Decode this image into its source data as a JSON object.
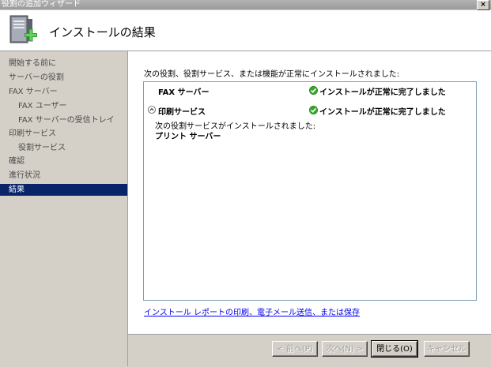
{
  "window": {
    "title": "役割の追加ウィザード",
    "close_glyph": "×"
  },
  "header": {
    "title": "インストールの結果"
  },
  "sidebar": {
    "items": [
      {
        "label": "開始する前に",
        "level": 1,
        "active": false
      },
      {
        "label": "サーバーの役割",
        "level": 1,
        "active": false
      },
      {
        "label": "FAX サーバー",
        "level": 1,
        "active": false
      },
      {
        "label": "FAX ユーザー",
        "level": 2,
        "active": false
      },
      {
        "label": "FAX サーバーの受信トレイ",
        "level": 2,
        "active": false
      },
      {
        "label": "印刷サービス",
        "level": 1,
        "active": false
      },
      {
        "label": "役割サービス",
        "level": 2,
        "active": false
      },
      {
        "label": "確認",
        "level": 1,
        "active": false
      },
      {
        "label": "進行状況",
        "level": 1,
        "active": false
      },
      {
        "label": "結果",
        "level": 1,
        "active": true
      }
    ]
  },
  "main": {
    "summary": "次の役割、役割サービス、または機能が正常にインストールされました:",
    "results": [
      {
        "name": "FAX サーバー",
        "status": "インストールが正常に完了しました"
      },
      {
        "name": "印刷サービス",
        "status": "インストールが正常に完了しました",
        "detail_heading": "次の役割サービスがインストールされました:",
        "detail_item": "プリント サーバー"
      }
    ],
    "report_link": "インストール レポートの印刷、電子メール送信、または保存"
  },
  "footer": {
    "back": "< 前へ(P)",
    "next": "次へ(N) >",
    "close": "閉じる(O)",
    "cancel": "キャンセル"
  },
  "colors": {
    "accent": "#0a246a",
    "success": "#3aa52b",
    "link": "#0000ee"
  }
}
